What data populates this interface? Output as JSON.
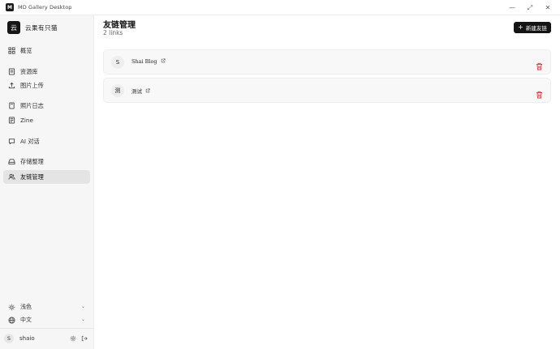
{
  "window": {
    "app_icon_letter": "M",
    "title": "MD Gallery Desktop",
    "controls": [
      "—",
      "⤢",
      "✕"
    ]
  },
  "brand": {
    "logo_char": "云",
    "name": "云果有只猫"
  },
  "sidebar": {
    "items": [
      {
        "label": "概览",
        "icon": "grid-icon"
      },
      {
        "label": "资源库",
        "icon": "library-icon"
      },
      {
        "label": "图片上传",
        "icon": "upload-icon"
      },
      {
        "label": "照片日志",
        "icon": "journal-icon"
      },
      {
        "label": "Zine",
        "icon": "zine-icon"
      },
      {
        "label": "AI 对话",
        "icon": "chat-icon"
      },
      {
        "label": "存储整理",
        "icon": "storage-icon"
      },
      {
        "label": "友链管理",
        "icon": "friends-icon",
        "active": true
      }
    ],
    "theme_label": "浅色",
    "language_label": "中文",
    "user": {
      "avatar_letter": "S",
      "name": "shaio"
    }
  },
  "main": {
    "title": "友链管理",
    "subtitle": "2 links",
    "new_button_label": "新建友链",
    "links": [
      {
        "avatar": "S",
        "name": "Shai Blog"
      },
      {
        "avatar": "测",
        "name": "测试"
      }
    ]
  },
  "colors": {
    "accent": "#141414",
    "danger": "#d43c3c",
    "sidebar_bg": "#f6f6f6",
    "active_bg": "#e4e4e4"
  }
}
